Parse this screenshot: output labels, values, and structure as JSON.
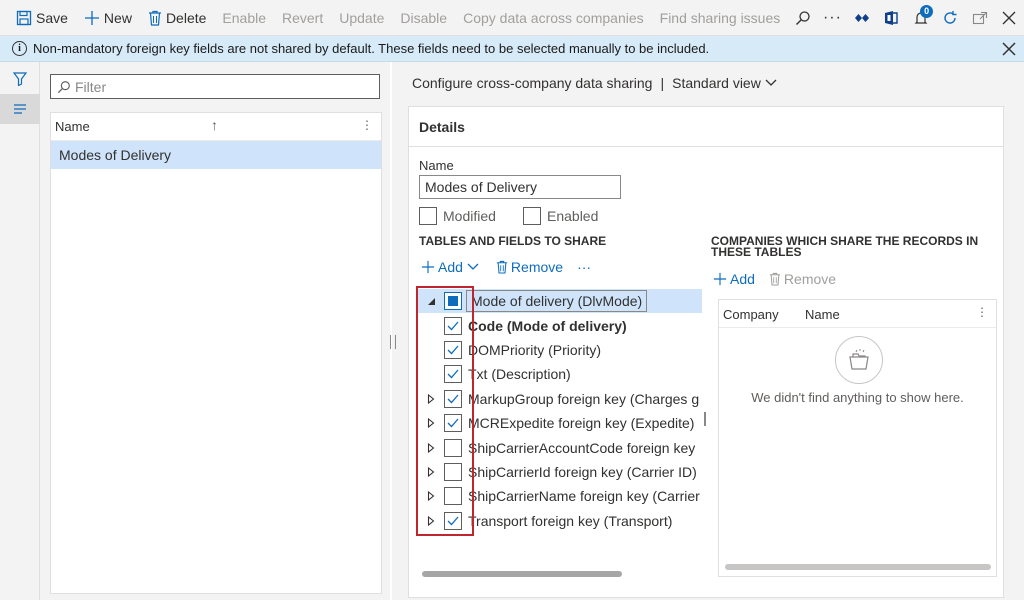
{
  "toolbar": {
    "save": "Save",
    "new": "New",
    "delete": "Delete",
    "enable": "Enable",
    "revert": "Revert",
    "update": "Update",
    "disable": "Disable",
    "copy_data": "Copy data across companies",
    "find_issues": "Find sharing issues",
    "notification_count": "0"
  },
  "infobar": {
    "message": "Non-mandatory foreign key fields are not shared by default. These fields need to be selected manually to be included."
  },
  "list": {
    "filter_placeholder": "Filter",
    "column_name": "Name",
    "rows": [
      "Modes of Delivery"
    ]
  },
  "content": {
    "title": "Configure cross-company data sharing",
    "separator": "|",
    "view": "Standard view",
    "details": {
      "header": "Details",
      "name_label": "Name",
      "name_value": "Modes of Delivery",
      "modified_label": "Modified",
      "enabled_label": "Enabled"
    },
    "tables": {
      "section_title": "TABLES AND FIELDS TO SHARE",
      "add": "Add",
      "remove": "Remove",
      "more": "···",
      "root": {
        "label": "Mode of delivery (DlvMode)",
        "state": "partial"
      },
      "fields": [
        {
          "label": "Code (Mode of delivery)",
          "checked": true,
          "expandable": false,
          "bold": true
        },
        {
          "label": "DOMPriority (Priority)",
          "checked": true,
          "expandable": false,
          "bold": false
        },
        {
          "label": "Txt (Description)",
          "checked": true,
          "expandable": false,
          "bold": false
        },
        {
          "label": "MarkupGroup foreign key (Charges g",
          "checked": true,
          "expandable": true,
          "bold": false
        },
        {
          "label": "MCRExpedite foreign key (Expedite)",
          "checked": true,
          "expandable": true,
          "bold": false
        },
        {
          "label": "ShipCarrierAccountCode foreign key",
          "checked": false,
          "expandable": true,
          "bold": false
        },
        {
          "label": "ShipCarrierId foreign key (Carrier ID)",
          "checked": false,
          "expandable": true,
          "bold": false
        },
        {
          "label": "ShipCarrierName foreign key (Carrier",
          "checked": false,
          "expandable": true,
          "bold": false
        },
        {
          "label": "Transport foreign key (Transport)",
          "checked": true,
          "expandable": true,
          "bold": false
        }
      ]
    },
    "companies": {
      "section_title": "COMPANIES WHICH SHARE THE RECORDS IN THESE TABLES",
      "add": "Add",
      "remove": "Remove",
      "col_company": "Company",
      "col_name": "Name",
      "empty_message": "We didn't find anything to show here."
    }
  },
  "colors": {
    "accent": "#0f6cbd",
    "selection": "#cfe4fa",
    "info_bar": "#d6eaf8",
    "highlight_box": "#c0262d"
  }
}
